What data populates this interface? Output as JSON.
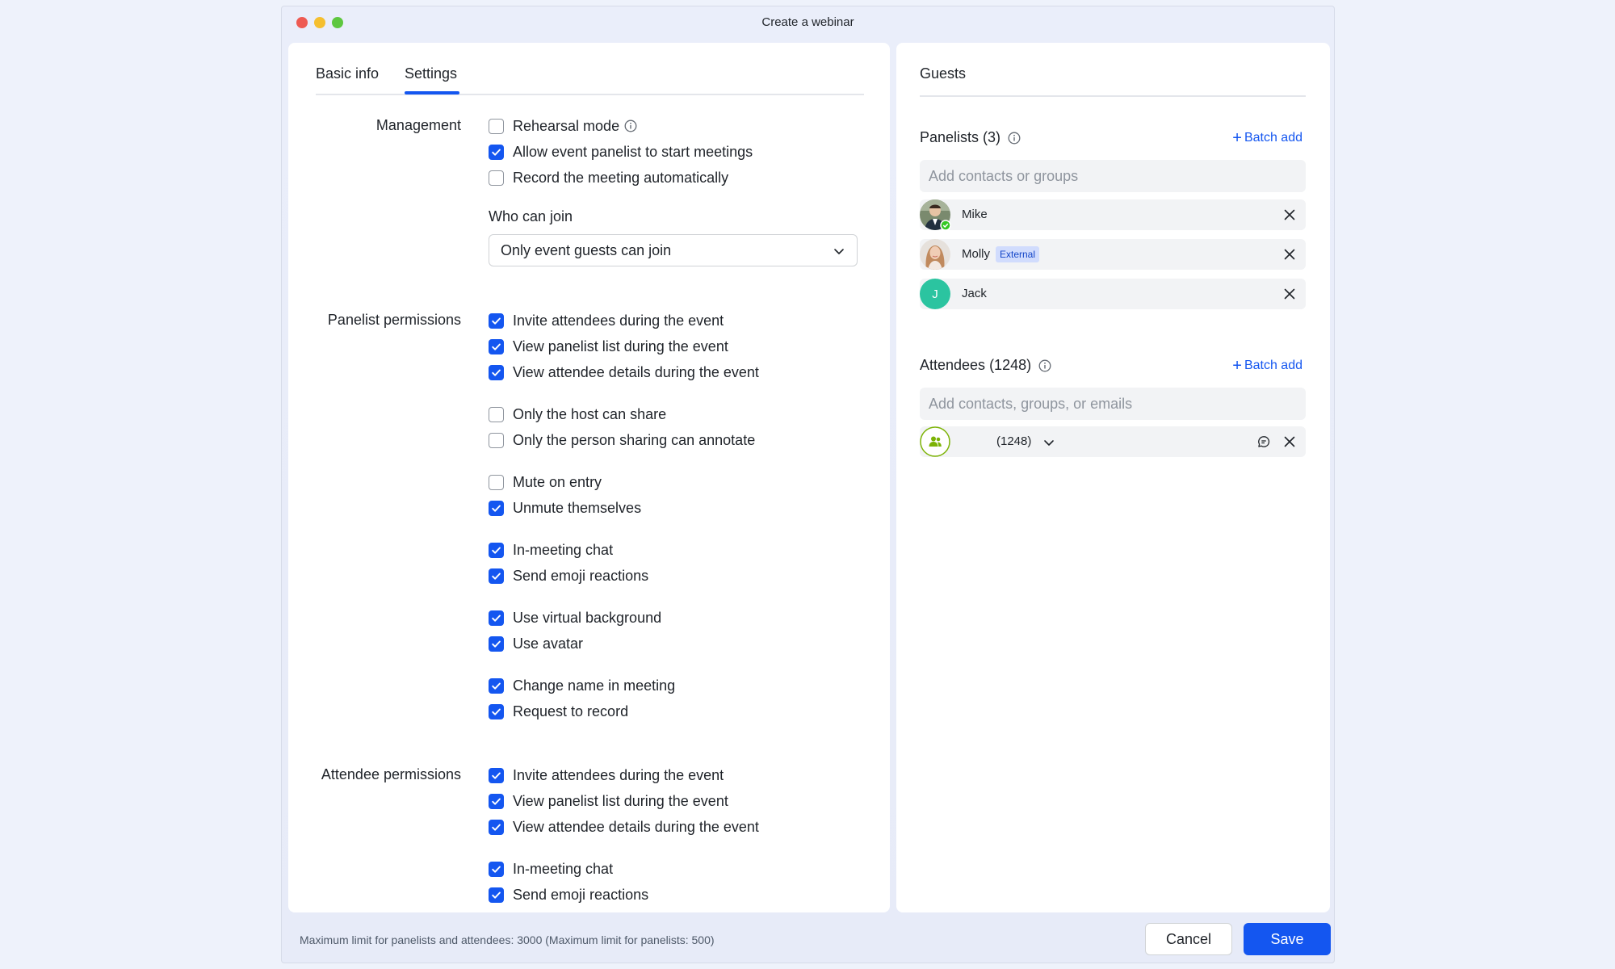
{
  "window": {
    "title": "Create a webinar"
  },
  "tabs": [
    {
      "label": "Basic info",
      "active": false
    },
    {
      "label": "Settings",
      "active": true
    }
  ],
  "management": {
    "label": "Management",
    "options": [
      {
        "label": "Rehearsal mode",
        "checked": false,
        "info": true
      },
      {
        "label": "Allow event panelist to start meetings",
        "checked": true
      },
      {
        "label": "Record the meeting automatically",
        "checked": false
      }
    ],
    "who_can_join": {
      "label": "Who can join",
      "value": "Only event guests can join"
    }
  },
  "panelist_permissions": {
    "label": "Panelist permissions",
    "options": [
      {
        "label": "Invite attendees during the event",
        "checked": true
      },
      {
        "label": "View panelist list during the event",
        "checked": true
      },
      {
        "label": "View attendee details during the event",
        "checked": true
      },
      {
        "label": "Only the host can share",
        "checked": false
      },
      {
        "label": "Only the person sharing can annotate",
        "checked": false
      },
      {
        "label": "Mute on entry",
        "checked": false
      },
      {
        "label": "Unmute themselves",
        "checked": true
      },
      {
        "label": "In-meeting chat",
        "checked": true
      },
      {
        "label": "Send emoji reactions",
        "checked": true
      },
      {
        "label": "Use virtual background",
        "checked": true
      },
      {
        "label": "Use avatar",
        "checked": true
      },
      {
        "label": "Change name in meeting",
        "checked": true
      },
      {
        "label": "Request to record",
        "checked": true
      }
    ]
  },
  "attendee_permissions": {
    "label": "Attendee permissions",
    "options": [
      {
        "label": "Invite attendees during the event",
        "checked": true
      },
      {
        "label": "View panelist list during the event",
        "checked": true
      },
      {
        "label": "View attendee details during the event",
        "checked": true
      },
      {
        "label": "In-meeting chat",
        "checked": true
      },
      {
        "label": "Send emoji reactions",
        "checked": true
      }
    ]
  },
  "guests": {
    "title": "Guests",
    "panelists": {
      "title": "Panelists (3)",
      "batch_add": "Batch add",
      "placeholder": "Add contacts or groups",
      "people": [
        {
          "name": "Mike",
          "verified": true
        },
        {
          "name": "Molly",
          "tag": "External"
        },
        {
          "name": "Jack",
          "initial": "J"
        }
      ]
    },
    "attendees": {
      "title": "Attendees (1248)",
      "batch_add": "Batch add",
      "placeholder": "Add contacts, groups, or emails",
      "group": {
        "count": "(1248)"
      }
    }
  },
  "footer": {
    "limit_text": "Maximum limit for panelists and attendees: 3000 (Maximum limit for panelists: 500)",
    "cancel": "Cancel",
    "save": "Save"
  },
  "colors": {
    "accent": "#1456f0",
    "jack_avatar": "#2bc4a0",
    "group_icon": "#7cb305"
  }
}
